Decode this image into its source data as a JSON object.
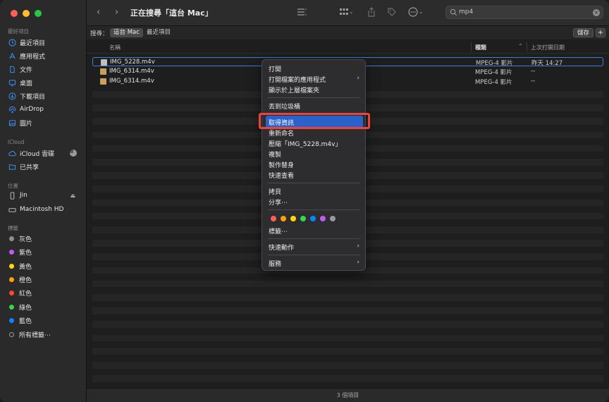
{
  "window": {
    "title": "正在搜尋「這台 Mac」"
  },
  "sidebar": {
    "sections": {
      "favorites": "最好項目",
      "icloud": "iCloud",
      "locations": "位置",
      "tags": "標籤"
    },
    "favorites": [
      {
        "label": "最近項目",
        "icon": "clock-icon"
      },
      {
        "label": "應用程式",
        "icon": "apps-icon"
      },
      {
        "label": "文件",
        "icon": "document-icon"
      },
      {
        "label": "桌面",
        "icon": "desktop-icon"
      },
      {
        "label": "下載項目",
        "icon": "download-icon"
      },
      {
        "label": "AirDrop",
        "icon": "airdrop-icon"
      },
      {
        "label": "圖片",
        "icon": "photo-icon"
      }
    ],
    "icloud": [
      {
        "label": "iCloud 雲碟",
        "icon": "cloud-icon"
      },
      {
        "label": "已共享",
        "icon": "shared-folder-icon"
      }
    ],
    "locations": [
      {
        "label": "Jin",
        "icon": "phone-icon"
      },
      {
        "label": "Macintosh HD",
        "icon": "hard-drive-icon"
      }
    ],
    "tags": [
      {
        "label": "灰色",
        "color": "#8e8e93"
      },
      {
        "label": "紫色",
        "color": "#bf5af2"
      },
      {
        "label": "黃色",
        "color": "#ffd60a"
      },
      {
        "label": "橙色",
        "color": "#ff9f0a"
      },
      {
        "label": "紅色",
        "color": "#ff453a"
      },
      {
        "label": "綠色",
        "color": "#32d74b"
      },
      {
        "label": "藍色",
        "color": "#0a84ff"
      },
      {
        "label": "所有標籤⋯",
        "color": ""
      }
    ]
  },
  "search": {
    "value": "mp4"
  },
  "scope": {
    "label": "搜尋：",
    "options": [
      "這台 Mac",
      "最近項目"
    ],
    "selected": "這台 Mac",
    "save_label": "儲存",
    "add_label": "+"
  },
  "columns": {
    "name": "名稱",
    "kind": "種類",
    "last_opened": "上次打開日期"
  },
  "files": [
    {
      "name": "IMG_5228.m4v",
      "kind": "MPEG-4 影片",
      "date": "昨天 14:27",
      "selected": true
    },
    {
      "name": "IMG_6314.m4v",
      "kind": "MPEG-4 影片",
      "date": "--",
      "selected": false
    },
    {
      "name": "IMG_6314.m4v",
      "kind": "MPEG-4 影片",
      "date": "--",
      "selected": false
    }
  ],
  "status": {
    "text": "3 個項目"
  },
  "context_menu": {
    "items": {
      "open": "打開",
      "open_with": "打開檔案的應用程式",
      "show_in_enclosing": "顯示於上層檔案夾",
      "trash": "丟到垃圾桶",
      "get_info": "取得資訊",
      "rename": "重新命名",
      "compress": "壓縮「IMG_5228.m4v」",
      "duplicate": "複製",
      "make_alias": "製作替身",
      "quick_look": "快速查看",
      "copy": "拷貝",
      "share": "分享⋯",
      "tags": "標籤⋯",
      "quick_actions": "快速動作",
      "services": "服務"
    },
    "highlighted": "取得資訊",
    "tag_colors": [
      "#ff5f57",
      "#ff9f0a",
      "#ffd60a",
      "#32d74b",
      "#0a84ff",
      "#bf5af2",
      "#98989d"
    ]
  }
}
